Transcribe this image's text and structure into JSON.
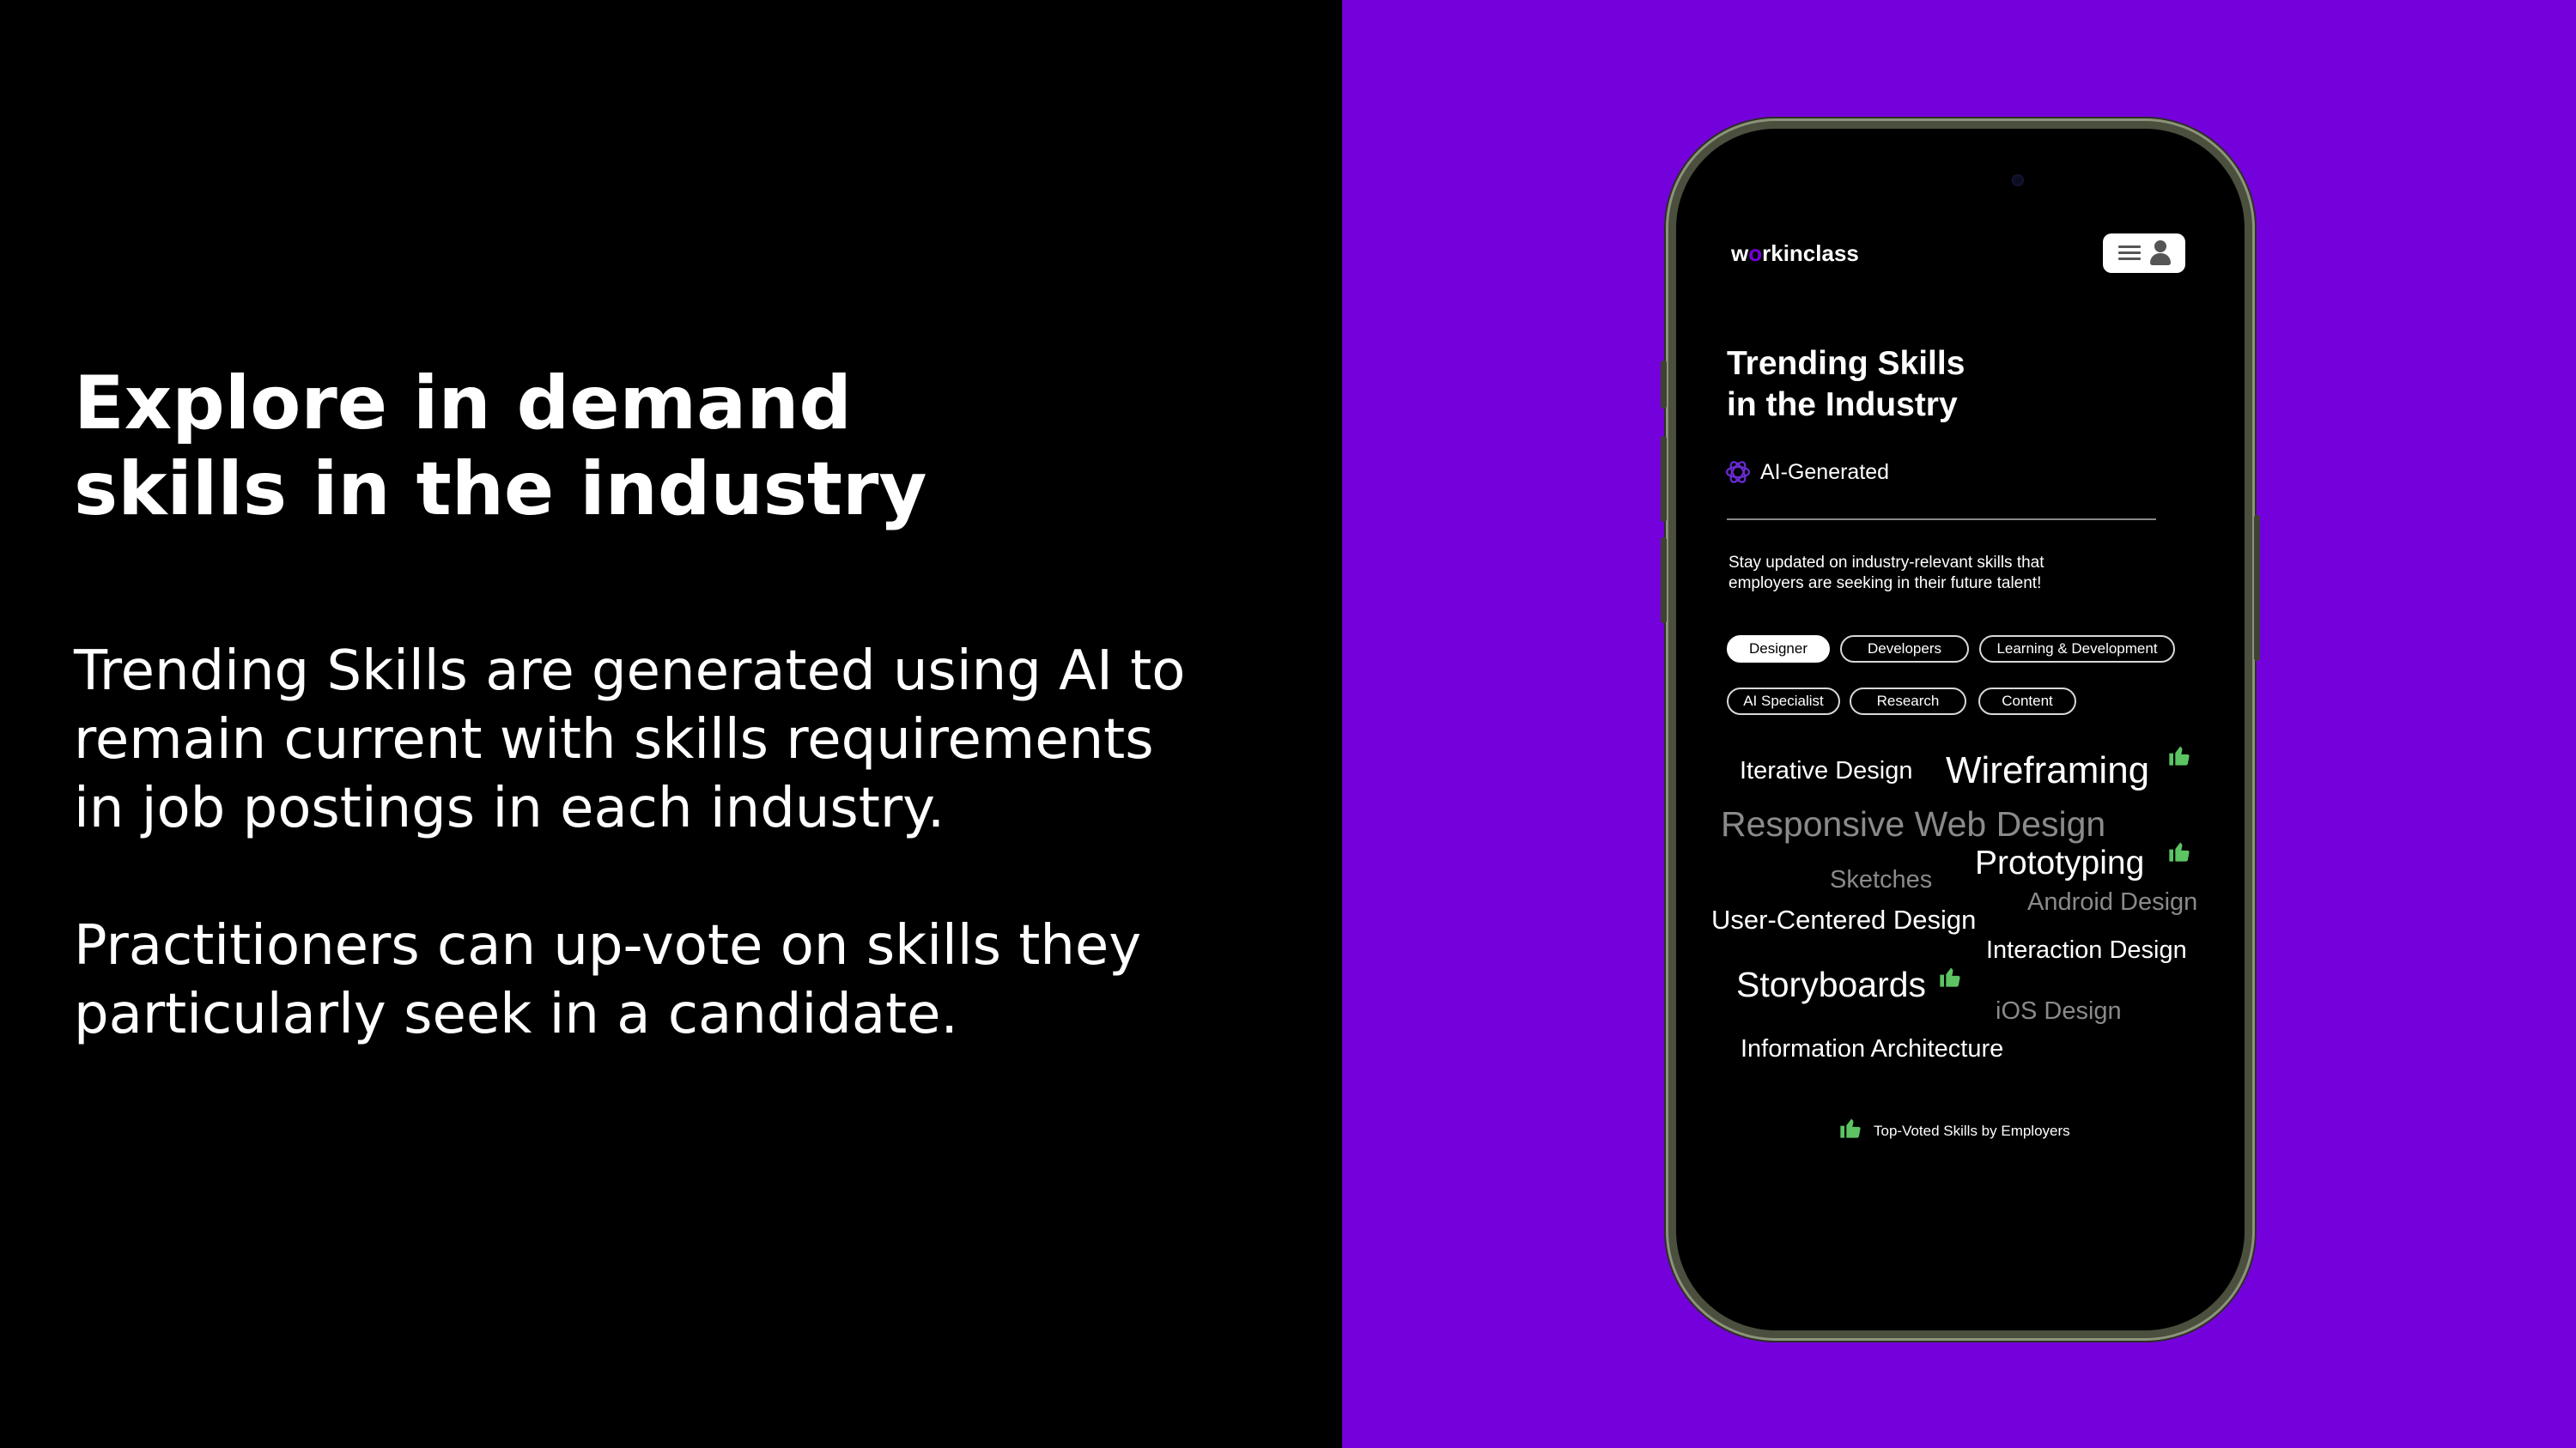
{
  "slide": {
    "headline": [
      "Explore in demand",
      "skills in the industry"
    ],
    "paragraph_1": [
      "Trending Skills are generated using AI to",
      "remain current with skills requirements",
      "in job postings in each industry."
    ],
    "paragraph_2": [
      "Practitioners can up-vote on skills they",
      "particularly seek in a candidate."
    ]
  },
  "colors": {
    "accent_purple": "#7400db",
    "upvote_green": "#5cc463",
    "background": "#000000"
  },
  "app": {
    "logo_text_1": "w",
    "logo_text_2": "o",
    "logo_text_3": "rkinclass",
    "menu_icons": [
      "hamburger-icon",
      "user-icon"
    ],
    "title": [
      "Trending Skills",
      "in the Industry"
    ],
    "ai_badge": "AI-Generated",
    "description": [
      "Stay updated on industry-relevant skills that",
      "employers are seeking in their future talent!"
    ],
    "categories": [
      "Designer",
      "Developers",
      "Learning & Development",
      "AI Specialist",
      "Research",
      "Content"
    ],
    "selected_category": "Designer",
    "skills": [
      {
        "name": "Iterative Design",
        "upvoted": false
      },
      {
        "name": "Wireframing",
        "upvoted": true
      },
      {
        "name": "Responsive Web Design",
        "upvoted": false
      },
      {
        "name": "Sketches",
        "upvoted": false
      },
      {
        "name": "Prototyping",
        "upvoted": true
      },
      {
        "name": "Android Design",
        "upvoted": false
      },
      {
        "name": "User-Centered Design",
        "upvoted": false
      },
      {
        "name": "Interaction Design",
        "upvoted": false
      },
      {
        "name": "Storyboards",
        "upvoted": true
      },
      {
        "name": "iOS Design",
        "upvoted": false
      },
      {
        "name": "Information Architecture",
        "upvoted": false
      }
    ],
    "legend": "Top-Voted Skills by Employers"
  }
}
